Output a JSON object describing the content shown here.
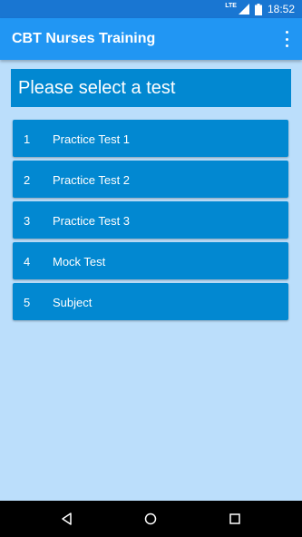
{
  "status_bar": {
    "network": "LTE",
    "time": "18:52"
  },
  "app_bar": {
    "title": "CBT Nurses Training",
    "menu_icon": "more-vert-icon"
  },
  "header": {
    "text": "Please select a test"
  },
  "tests": [
    {
      "number": "1",
      "label": "Practice Test 1"
    },
    {
      "number": "2",
      "label": "Practice Test 2"
    },
    {
      "number": "3",
      "label": "Practice Test 3"
    },
    {
      "number": "4",
      "label": "Mock Test"
    },
    {
      "number": "5",
      "label": "Subject"
    }
  ],
  "nav": {
    "back_icon": "back-icon",
    "home_icon": "home-icon",
    "recents_icon": "recents-icon"
  },
  "colors": {
    "status": "#1976D2",
    "app_bar": "#2196F3",
    "accent": "#0288D1",
    "background": "#BBDEFB"
  }
}
